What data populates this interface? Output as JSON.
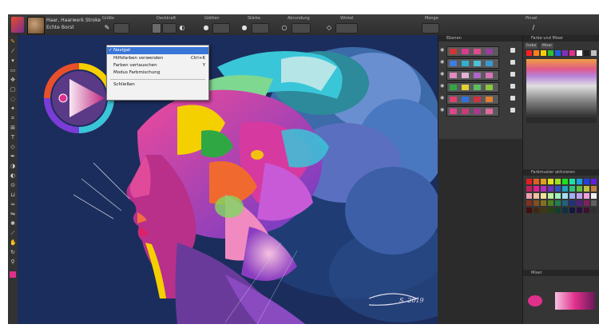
{
  "propbar": {
    "brush_name_1": "Haar, Haarwerk Stroke",
    "brush_name_2": "Echte Borst",
    "labels": [
      "Größe",
      "Deckkraft",
      "Glätten",
      "Stärke",
      "Abrundung",
      "Winkel",
      "Menge",
      "Pinsel"
    ],
    "size_icon": "brush-size-icon",
    "opacity_icon": "opacity-icon"
  },
  "menu": {
    "items": [
      {
        "label": "Navigat",
        "shortcut": "",
        "checked": true,
        "selected": true
      },
      {
        "label": "Hilfsfarben verwenden",
        "shortcut": "Ctrl+K",
        "checked": false,
        "selected": false
      },
      {
        "label": "Farben vertauschen",
        "shortcut": "Y",
        "checked": false,
        "selected": false
      },
      {
        "label": "Modus Farbmischung",
        "shortcut": "",
        "checked": false,
        "selected": false
      },
      {
        "label": "Schließen",
        "shortcut": "",
        "checked": false,
        "selected": false
      }
    ]
  },
  "panels": {
    "layers_title": "Ebenen",
    "color_title": "Farbe und Mixer",
    "color_tab_1": "Farbe",
    "color_tab_2": "Mixer",
    "swatches_title": "Farbmuster aktivieren",
    "mixer_title": "Mixer"
  },
  "colors": {
    "canvas_bg": "#1b2d5c",
    "accent_magenta": "#e0308c",
    "accent_yellow": "#f5d000",
    "accent_cyan": "#39c6d8",
    "menu_highlight": "#3a76d6"
  },
  "canvas": {
    "signature": "S. 2019"
  },
  "layers": [
    {
      "colors": [
        "#d13535",
        "#d93a8f",
        "#e04b8e",
        "#9a3da0"
      ]
    },
    {
      "colors": [
        "#3d7de0",
        "#2fb0d0",
        "#4cc0d8",
        "#3a9ad0"
      ]
    },
    {
      "colors": [
        "#e08ac0",
        "#e4b0d4",
        "#b066c8",
        "#d874b8"
      ]
    },
    {
      "colors": [
        "#2fa844",
        "#e0d030",
        "#58c060",
        "#8ac840"
      ]
    },
    {
      "colors": [
        "#e04070",
        "#3070e0",
        "#d03040",
        "#e08030"
      ]
    },
    {
      "colors": [
        "#e04590",
        "#c83a7a",
        "#a83a90",
        "#e06aa0"
      ]
    }
  ]
}
